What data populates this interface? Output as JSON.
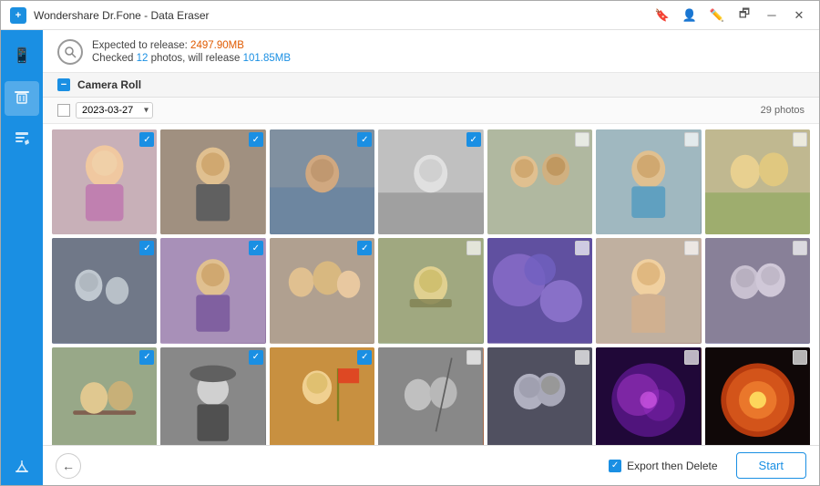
{
  "titleBar": {
    "title": "Wondershare Dr.Fone - Data Eraser",
    "iconLabel": "+",
    "controls": [
      "bookmark",
      "person",
      "edit",
      "window",
      "minimize",
      "close"
    ]
  },
  "infoBar": {
    "line1": {
      "prefix": "Expected to release: ",
      "value": "2497.90MB",
      "valueColor": "orange"
    },
    "line2": {
      "prefix": "Checked ",
      "count": "12",
      "middle": " photos, will release ",
      "value": "101.85MB",
      "valueColor": "blue"
    }
  },
  "section": {
    "title": "Camera Roll"
  },
  "dateFilter": {
    "date": "2023-03-27",
    "photoCount": "29 photos"
  },
  "photos": {
    "items": [
      {
        "id": 1,
        "checked": true,
        "bg": "photo-bg-1"
      },
      {
        "id": 2,
        "checked": true,
        "bg": "photo-bg-2"
      },
      {
        "id": 3,
        "checked": true,
        "bg": "photo-bg-3"
      },
      {
        "id": 4,
        "checked": true,
        "bg": "photo-bg-4"
      },
      {
        "id": 5,
        "checked": false,
        "bg": "photo-bg-5"
      },
      {
        "id": 6,
        "checked": false,
        "bg": "photo-bg-6"
      },
      {
        "id": 7,
        "checked": false,
        "bg": "photo-bg-7"
      },
      {
        "id": 8,
        "checked": true,
        "bg": "photo-bg-8"
      },
      {
        "id": 9,
        "checked": true,
        "bg": "photo-bg-9"
      },
      {
        "id": 10,
        "checked": true,
        "bg": "photo-bg-10"
      },
      {
        "id": 11,
        "checked": false,
        "bg": "photo-bg-11"
      },
      {
        "id": 12,
        "checked": false,
        "bg": "photo-bg-12"
      },
      {
        "id": 13,
        "checked": false,
        "bg": "photo-bg-13"
      },
      {
        "id": 14,
        "checked": false,
        "bg": "photo-bg-14"
      },
      {
        "id": 15,
        "checked": true,
        "bg": "photo-bg-15"
      },
      {
        "id": 16,
        "checked": true,
        "bg": "photo-bg-16"
      },
      {
        "id": 17,
        "checked": true,
        "bg": "photo-bg-17"
      },
      {
        "id": 18,
        "checked": false,
        "bg": "photo-bg-18"
      },
      {
        "id": 19,
        "checked": false,
        "bg": "photo-bg-19"
      },
      {
        "id": 20,
        "checked": false,
        "bg": "photo-bg-20"
      },
      {
        "id": 21,
        "checked": false,
        "bg": "photo-bg-21"
      }
    ]
  },
  "bottomBar": {
    "backButton": "←",
    "exportLabel": "Export then Delete",
    "exportChecked": true,
    "startLabel": "Start"
  },
  "sidebar": {
    "items": [
      {
        "name": "phone-icon",
        "icon": "📱",
        "active": false
      },
      {
        "name": "erase-icon",
        "icon": "🗑",
        "active": true
      },
      {
        "name": "edit-icon",
        "icon": "✏️",
        "active": false
      },
      {
        "name": "clean-icon",
        "icon": "🧹",
        "active": false
      }
    ]
  }
}
